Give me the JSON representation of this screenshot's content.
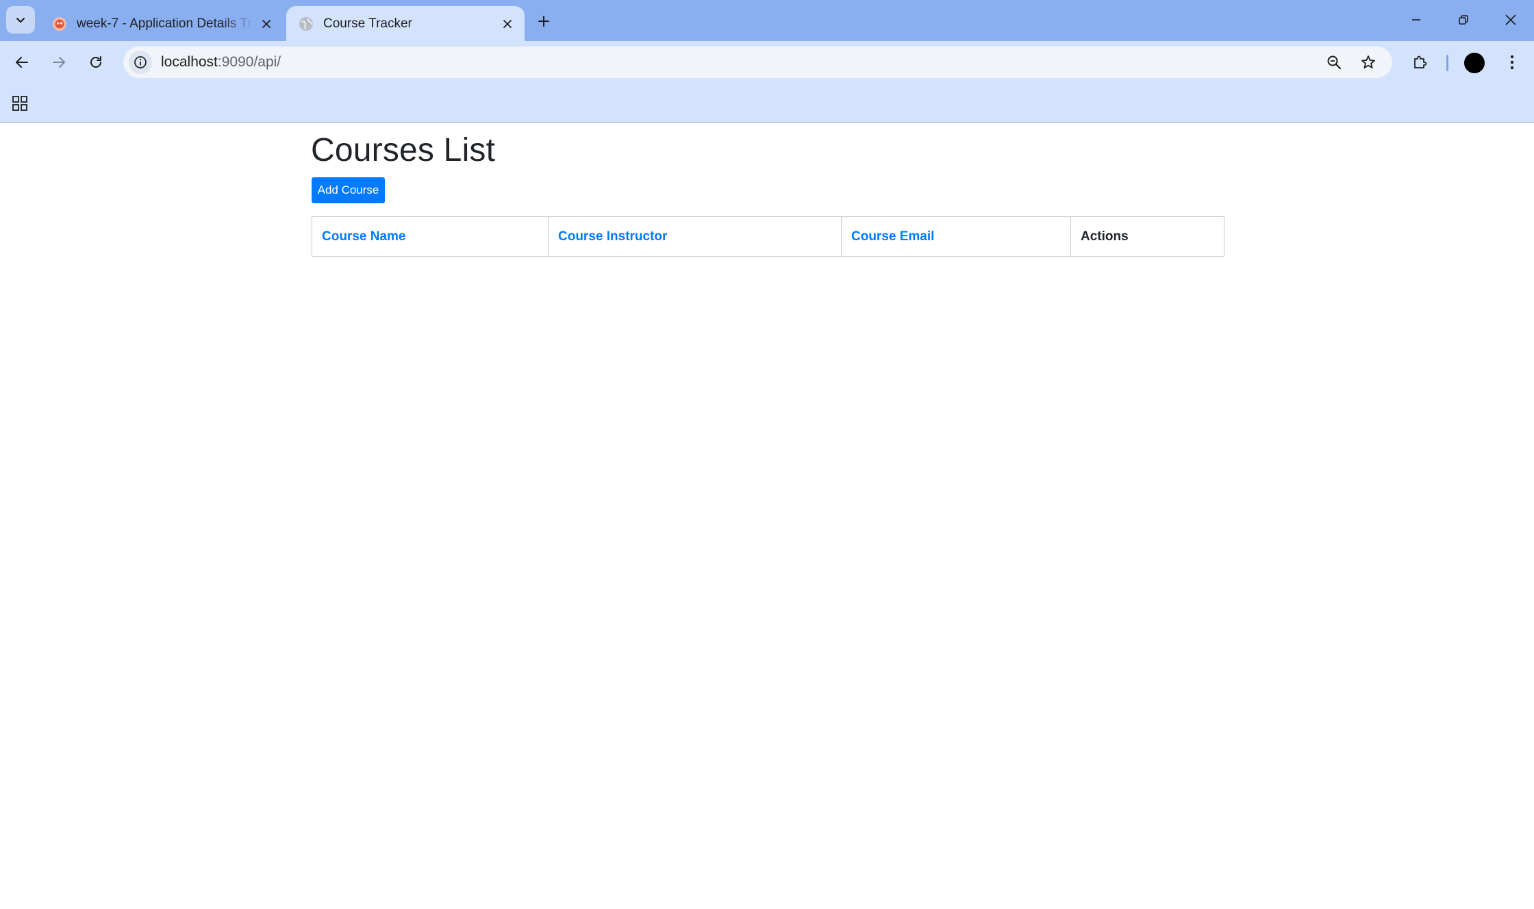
{
  "browser": {
    "tabs": [
      {
        "title": "week-7 - Application Details Tracker",
        "active": false
      },
      {
        "title": "Course Tracker",
        "active": true
      }
    ],
    "url": {
      "host": "localhost",
      "rest": ":9090/api/"
    }
  },
  "page": {
    "title": "Courses List",
    "add_button_label": "Add Course",
    "table": {
      "columns": [
        {
          "label": "Course Name",
          "sortable": true
        },
        {
          "label": "Course Instructor",
          "sortable": true
        },
        {
          "label": "Course Email",
          "sortable": true
        },
        {
          "label": "Actions",
          "sortable": false
        }
      ],
      "rows": []
    }
  },
  "colors": {
    "tabstrip": "#8aaff0",
    "toolbar": "#d3e3fd",
    "primary": "#007bff",
    "heading_text": "#212529"
  }
}
